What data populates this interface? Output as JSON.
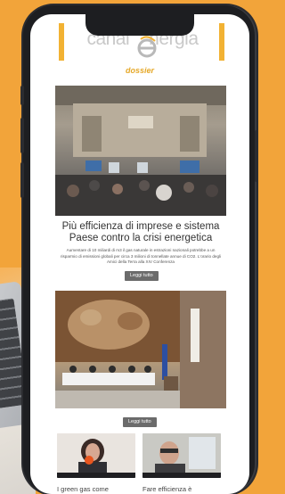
{
  "colors": {
    "background_orange": "#f2a43a",
    "logo_gold": "#f2b233",
    "dossier_gold": "#e6a92a",
    "button_gray": "#6b6b6b",
    "orange_dot": "#e9561f"
  },
  "header": {
    "logo_left": "canal",
    "logo_right": "nergia",
    "section": "dossier"
  },
  "articles": [
    {
      "title": "Più efficienza di imprese e sistema Paese contro la crisi energetica",
      "description": "Aumentare di 10 miliardi di m3 il gas naturale in estrazioni nazionali potrebbe a un risparmio di emissioni globali per circa 3 milioni di tonnellate annue di CO2. L'orario degli Amici della Terra alla XIV Conferenza",
      "button": "Leggi tutto",
      "photo_icon": "conference-hall-photo"
    },
    {
      "button": "Leggi tutto",
      "photo_icon": "fresco-hall-press-conference-photo"
    }
  ],
  "cards": [
    {
      "title": "I green gas come",
      "thumb_icon": "woman-speaker-video-thumbnail"
    },
    {
      "title": "Fare efficienza è",
      "thumb_icon": "man-speaker-video-thumbnail"
    }
  ]
}
